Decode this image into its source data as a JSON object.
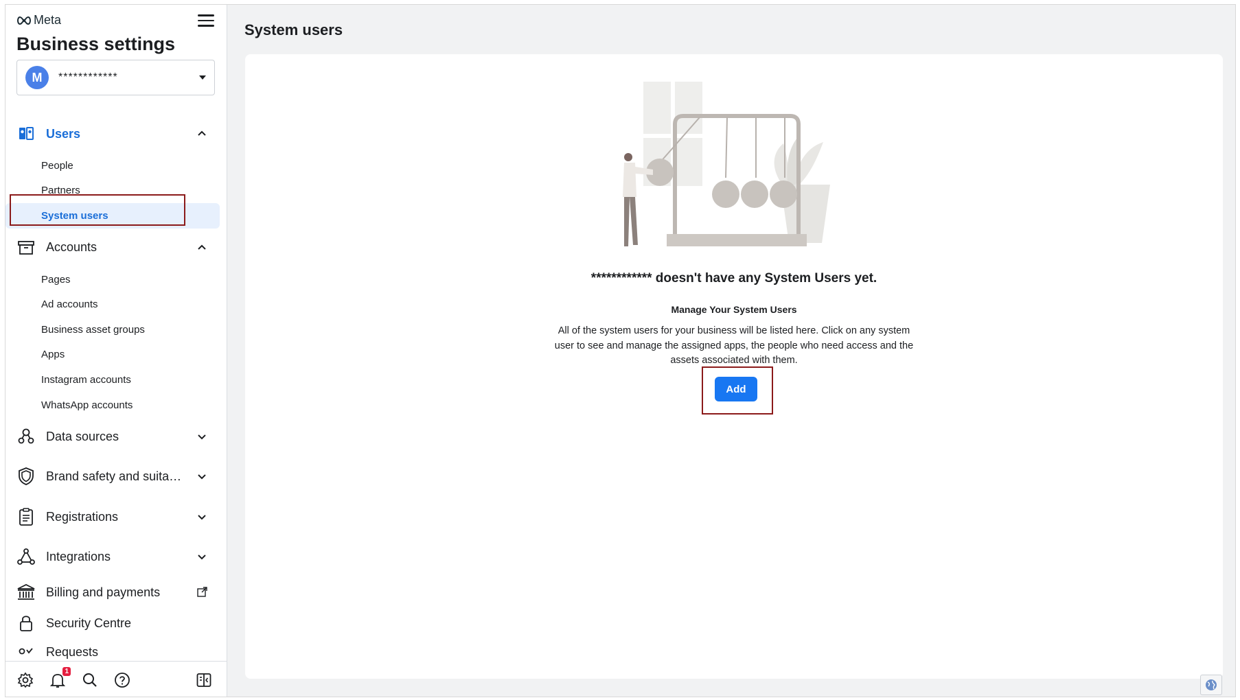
{
  "brand": {
    "name": "Meta"
  },
  "sidebar": {
    "title": "Business settings",
    "account": {
      "initial": "M",
      "name": "************"
    },
    "groups": [
      {
        "label": "Users",
        "items": [
          "People",
          "Partners",
          "System users"
        ]
      },
      {
        "label": "Accounts",
        "items": [
          "Pages",
          "Ad accounts",
          "Business asset groups",
          "Apps",
          "Instagram accounts",
          "WhatsApp accounts"
        ]
      },
      {
        "label": "Data sources"
      },
      {
        "label": "Brand safety and suitabil..."
      },
      {
        "label": "Registrations"
      },
      {
        "label": "Integrations"
      },
      {
        "label": "Billing and payments"
      },
      {
        "label": "Security Centre"
      },
      {
        "label": "Requests"
      }
    ],
    "footer": {
      "notification_count": "1"
    }
  },
  "main": {
    "title": "System users",
    "empty_state": {
      "heading": "************ doesn't have any System Users yet.",
      "subheading": "Manage Your System Users",
      "description": "All of the system users for your business will be listed here. Click on any system user to see and manage the assigned apps, the people who need access and the assets associated with them.",
      "add_label": "Add"
    }
  },
  "colors": {
    "accent": "#1877f2",
    "active_text": "#1a6ed8",
    "highlight_box": "#8b1a1a"
  }
}
